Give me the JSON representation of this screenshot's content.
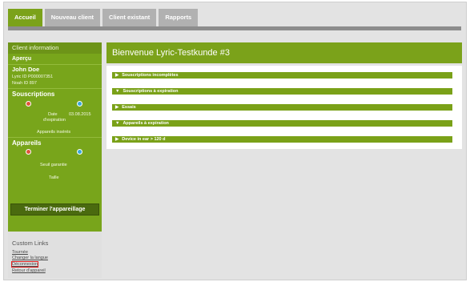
{
  "tabs": [
    {
      "label": "Accueil",
      "active": true
    },
    {
      "label": "Nouveau client",
      "active": false
    },
    {
      "label": "Client existant",
      "active": false
    },
    {
      "label": "Rapports",
      "active": false
    }
  ],
  "sidebar": {
    "header": "Client information",
    "apercu_label": "Aperçu",
    "client_name": "John Doe",
    "lyric_id": "Lyric ID P000007351",
    "noah_id": "Noah ID 897",
    "souscriptions": {
      "title": "Souscriptions",
      "date_label": "Date",
      "date_label2": "d'expiration",
      "date_value": "03.08.2015",
      "link": "Appareils insérés"
    },
    "appareils": {
      "title": "Appareils",
      "line1": "Seuil garantie",
      "line2": "Taille"
    },
    "finish_button": "Terminer l'appareillage",
    "custom_links": {
      "title": "Custom Links",
      "links": [
        "Tournée",
        "Changer la langue",
        "Déconnexion",
        "Retour d'appareil"
      ]
    }
  },
  "main": {
    "title": "Bienvenue Lyric-Testkunde #3",
    "accordions": [
      {
        "arrow": "▶",
        "label": "Souscriptions incomplètes"
      },
      {
        "arrow": "▼",
        "label": "Souscriptions à expiration"
      },
      {
        "arrow": "▶",
        "label": "Essais"
      },
      {
        "arrow": "▼",
        "label": "Appareils à expiration"
      },
      {
        "arrow": "▶",
        "label": "Device in ear > 120 d"
      }
    ]
  },
  "colors": {
    "brand_green": "#7ba21a",
    "dark_green": "#4a6a0f",
    "tab_grey": "#b1b1b1",
    "highlight_red": "#e02020"
  }
}
